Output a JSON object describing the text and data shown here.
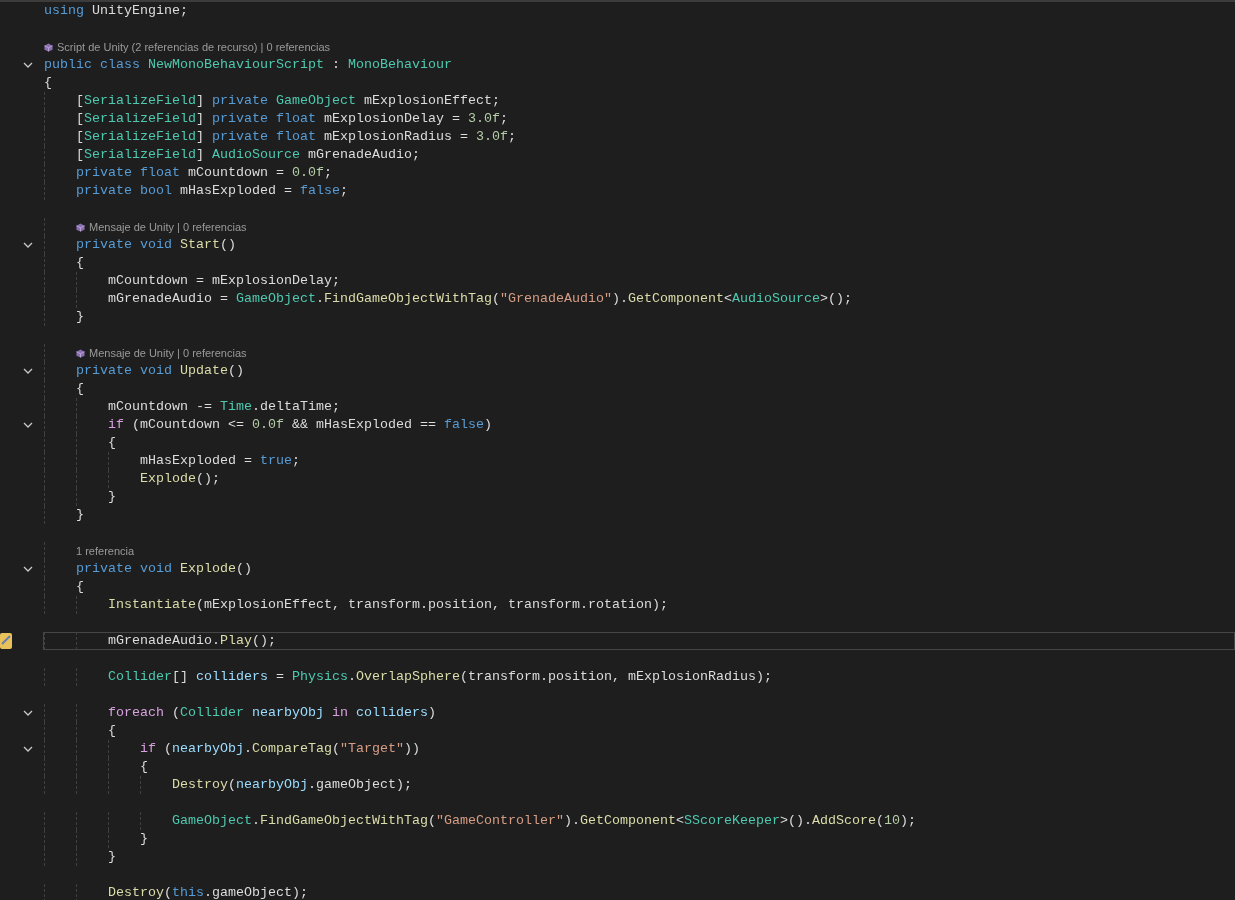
{
  "lines": [
    {
      "kind": "code",
      "current": false,
      "tokens": [
        {
          "kind": "keyword",
          "text": "using"
        },
        {
          "kind": "plain",
          "text": " UnityEngine;"
        }
      ]
    },
    {
      "kind": "blank",
      "current": false
    },
    {
      "kind": "lens",
      "current": false,
      "unity_icon": true,
      "text": "Script de Unity (2 referencias de recurso) | 0 referencias"
    },
    {
      "kind": "code",
      "current": false,
      "expanded": true,
      "tokens": [
        {
          "kind": "keyword",
          "text": "public class "
        },
        {
          "kind": "type",
          "text": "NewMonoBehaviourScript"
        },
        {
          "kind": "plain",
          "text": " : "
        },
        {
          "kind": "type",
          "text": "MonoBehaviour"
        }
      ]
    },
    {
      "kind": "code",
      "current": false,
      "tokens": [
        {
          "kind": "plain",
          "text": "{"
        }
      ]
    },
    {
      "kind": "code",
      "current": false,
      "tokens": [
        {
          "kind": "plain",
          "text": "    ["
        },
        {
          "kind": "type",
          "text": "SerializeField"
        },
        {
          "kind": "plain",
          "text": "] "
        },
        {
          "kind": "keyword",
          "text": "private "
        },
        {
          "kind": "type",
          "text": "GameObject"
        },
        {
          "kind": "plain",
          "text": " mExplosionEffect;"
        }
      ]
    },
    {
      "kind": "code",
      "current": false,
      "tokens": [
        {
          "kind": "plain",
          "text": "    ["
        },
        {
          "kind": "type",
          "text": "SerializeField"
        },
        {
          "kind": "plain",
          "text": "] "
        },
        {
          "kind": "keyword",
          "text": "private float"
        },
        {
          "kind": "plain",
          "text": " mExplosionDelay = "
        },
        {
          "kind": "number",
          "text": "3.0f"
        },
        {
          "kind": "plain",
          "text": ";"
        }
      ]
    },
    {
      "kind": "code",
      "current": false,
      "tokens": [
        {
          "kind": "plain",
          "text": "    ["
        },
        {
          "kind": "type",
          "text": "SerializeField"
        },
        {
          "kind": "plain",
          "text": "] "
        },
        {
          "kind": "keyword",
          "text": "private float"
        },
        {
          "kind": "plain",
          "text": " mExplosionRadius = "
        },
        {
          "kind": "number",
          "text": "3.0f"
        },
        {
          "kind": "plain",
          "text": ";"
        }
      ]
    },
    {
      "kind": "code",
      "current": false,
      "tokens": [
        {
          "kind": "plain",
          "text": "    ["
        },
        {
          "kind": "type",
          "text": "SerializeField"
        },
        {
          "kind": "plain",
          "text": "] "
        },
        {
          "kind": "type",
          "text": "AudioSource"
        },
        {
          "kind": "plain",
          "text": " mGrenadeAudio;"
        }
      ]
    },
    {
      "kind": "code",
      "current": false,
      "tokens": [
        {
          "kind": "keyword",
          "text": "    private float"
        },
        {
          "kind": "plain",
          "text": " mCountdown = "
        },
        {
          "kind": "number",
          "text": "0.0f"
        },
        {
          "kind": "plain",
          "text": ";"
        }
      ]
    },
    {
      "kind": "code",
      "current": false,
      "tokens": [
        {
          "kind": "keyword",
          "text": "    private bool"
        },
        {
          "kind": "plain",
          "text": " mHasExploded = "
        },
        {
          "kind": "keyword",
          "text": "false"
        },
        {
          "kind": "plain",
          "text": ";"
        }
      ]
    },
    {
      "kind": "blank",
      "current": false
    },
    {
      "kind": "lens",
      "current": false,
      "unity_icon": true,
      "text": "Mensaje de Unity | 0 referencias"
    },
    {
      "kind": "code",
      "current": false,
      "expanded": true,
      "tokens": [
        {
          "kind": "keyword",
          "text": "    private void "
        },
        {
          "kind": "method",
          "text": "Start"
        },
        {
          "kind": "plain",
          "text": "()"
        }
      ]
    },
    {
      "kind": "code",
      "current": false,
      "tokens": [
        {
          "kind": "plain",
          "text": "    {"
        }
      ]
    },
    {
      "kind": "code",
      "current": false,
      "tokens": [
        {
          "kind": "plain",
          "text": "        mCountdown = mExplosionDelay;"
        }
      ]
    },
    {
      "kind": "code",
      "current": false,
      "tokens": [
        {
          "kind": "plain",
          "text": "        mGrenadeAudio = "
        },
        {
          "kind": "type",
          "text": "GameObject"
        },
        {
          "kind": "plain",
          "text": "."
        },
        {
          "kind": "method",
          "text": "FindGameObjectWithTag"
        },
        {
          "kind": "plain",
          "text": "("
        },
        {
          "kind": "string",
          "text": "\"GrenadeAudio\""
        },
        {
          "kind": "plain",
          "text": ")."
        },
        {
          "kind": "method",
          "text": "GetComponent"
        },
        {
          "kind": "plain",
          "text": "<"
        },
        {
          "kind": "type",
          "text": "AudioSource"
        },
        {
          "kind": "plain",
          "text": ">();"
        }
      ]
    },
    {
      "kind": "code",
      "current": false,
      "tokens": [
        {
          "kind": "plain",
          "text": "    }"
        }
      ]
    },
    {
      "kind": "blank",
      "current": false
    },
    {
      "kind": "lens",
      "current": false,
      "unity_icon": true,
      "text": "Mensaje de Unity | 0 referencias"
    },
    {
      "kind": "code",
      "current": false,
      "expanded": true,
      "tokens": [
        {
          "kind": "keyword",
          "text": "    private void "
        },
        {
          "kind": "method",
          "text": "Update"
        },
        {
          "kind": "plain",
          "text": "()"
        }
      ]
    },
    {
      "kind": "code",
      "current": false,
      "tokens": [
        {
          "kind": "plain",
          "text": "    {"
        }
      ]
    },
    {
      "kind": "code",
      "current": false,
      "tokens": [
        {
          "kind": "plain",
          "text": "        mCountdown -= "
        },
        {
          "kind": "type",
          "text": "Time"
        },
        {
          "kind": "plain",
          "text": ".deltaTime;"
        }
      ]
    },
    {
      "kind": "code",
      "current": false,
      "expanded": true,
      "tokens": [
        {
          "kind": "control",
          "text": "        if"
        },
        {
          "kind": "plain",
          "text": " (mCountdown <= "
        },
        {
          "kind": "number",
          "text": "0.0f"
        },
        {
          "kind": "plain",
          "text": " && mHasExploded == "
        },
        {
          "kind": "keyword",
          "text": "false"
        },
        {
          "kind": "plain",
          "text": ")"
        }
      ]
    },
    {
      "kind": "code",
      "current": false,
      "tokens": [
        {
          "kind": "plain",
          "text": "        {"
        }
      ]
    },
    {
      "kind": "code",
      "current": false,
      "tokens": [
        {
          "kind": "plain",
          "text": "            mHasExploded = "
        },
        {
          "kind": "keyword",
          "text": "true"
        },
        {
          "kind": "plain",
          "text": ";"
        }
      ]
    },
    {
      "kind": "code",
      "current": false,
      "tokens": [
        {
          "kind": "method",
          "text": "            Explode"
        },
        {
          "kind": "plain",
          "text": "();"
        }
      ]
    },
    {
      "kind": "code",
      "current": false,
      "tokens": [
        {
          "kind": "plain",
          "text": "        }"
        }
      ]
    },
    {
      "kind": "code",
      "current": false,
      "tokens": [
        {
          "kind": "plain",
          "text": "    }"
        }
      ]
    },
    {
      "kind": "blank",
      "current": false
    },
    {
      "kind": "lens",
      "current": false,
      "unity_icon": false,
      "text": "1 referencia"
    },
    {
      "kind": "code",
      "current": false,
      "expanded": true,
      "tokens": [
        {
          "kind": "keyword",
          "text": "    private void "
        },
        {
          "kind": "method",
          "text": "Explode"
        },
        {
          "kind": "plain",
          "text": "()"
        }
      ]
    },
    {
      "kind": "code",
      "current": false,
      "tokens": [
        {
          "kind": "plain",
          "text": "    {"
        }
      ]
    },
    {
      "kind": "code",
      "current": false,
      "tokens": [
        {
          "kind": "method",
          "text": "        Instantiate"
        },
        {
          "kind": "plain",
          "text": "(mExplosionEffect, transform.position, transform.rotation);"
        }
      ]
    },
    {
      "kind": "blank",
      "current": false
    },
    {
      "kind": "code",
      "current": true,
      "tokens": [
        {
          "kind": "plain",
          "text": "        mGrenadeAudio."
        },
        {
          "kind": "method",
          "text": "Play"
        },
        {
          "kind": "plain",
          "text": "();"
        }
      ]
    },
    {
      "kind": "blank",
      "current": false
    },
    {
      "kind": "code",
      "current": false,
      "tokens": [
        {
          "kind": "type",
          "text": "        Collider"
        },
        {
          "kind": "plain",
          "text": "[] "
        },
        {
          "kind": "local",
          "text": "colliders"
        },
        {
          "kind": "plain",
          "text": " = "
        },
        {
          "kind": "type",
          "text": "Physics"
        },
        {
          "kind": "plain",
          "text": "."
        },
        {
          "kind": "method",
          "text": "OverlapSphere"
        },
        {
          "kind": "plain",
          "text": "(transform.position, mExplosionRadius);"
        }
      ]
    },
    {
      "kind": "blank",
      "current": false
    },
    {
      "kind": "code",
      "current": false,
      "expanded": true,
      "tokens": [
        {
          "kind": "control",
          "text": "        foreach"
        },
        {
          "kind": "plain",
          "text": " ("
        },
        {
          "kind": "type",
          "text": "Collider "
        },
        {
          "kind": "local",
          "text": "nearbyObj "
        },
        {
          "kind": "control",
          "text": "in "
        },
        {
          "kind": "local",
          "text": "colliders"
        },
        {
          "kind": "plain",
          "text": ")"
        }
      ]
    },
    {
      "kind": "code",
      "current": false,
      "tokens": [
        {
          "kind": "plain",
          "text": "        {"
        }
      ]
    },
    {
      "kind": "code",
      "current": false,
      "expanded": true,
      "tokens": [
        {
          "kind": "control",
          "text": "            if"
        },
        {
          "kind": "plain",
          "text": " ("
        },
        {
          "kind": "local",
          "text": "nearbyObj"
        },
        {
          "kind": "plain",
          "text": "."
        },
        {
          "kind": "method",
          "text": "CompareTag"
        },
        {
          "kind": "plain",
          "text": "("
        },
        {
          "kind": "string",
          "text": "\"Target\""
        },
        {
          "kind": "plain",
          "text": "))"
        }
      ]
    },
    {
      "kind": "code",
      "current": false,
      "tokens": [
        {
          "kind": "plain",
          "text": "            {"
        }
      ]
    },
    {
      "kind": "code",
      "current": false,
      "tokens": [
        {
          "kind": "method",
          "text": "                Destroy"
        },
        {
          "kind": "plain",
          "text": "("
        },
        {
          "kind": "local",
          "text": "nearbyObj"
        },
        {
          "kind": "plain",
          "text": ".gameObject);"
        }
      ]
    },
    {
      "kind": "blank",
      "current": false
    },
    {
      "kind": "code",
      "current": false,
      "tokens": [
        {
          "kind": "type",
          "text": "                GameObject"
        },
        {
          "kind": "plain",
          "text": "."
        },
        {
          "kind": "method",
          "text": "FindGameObjectWithTag"
        },
        {
          "kind": "plain",
          "text": "("
        },
        {
          "kind": "string",
          "text": "\"GameController\""
        },
        {
          "kind": "plain",
          "text": ")."
        },
        {
          "kind": "method",
          "text": "GetComponent"
        },
        {
          "kind": "plain",
          "text": "<"
        },
        {
          "kind": "type",
          "text": "SScoreKeeper"
        },
        {
          "kind": "plain",
          "text": ">()."
        },
        {
          "kind": "method",
          "text": "AddScore"
        },
        {
          "kind": "plain",
          "text": "("
        },
        {
          "kind": "number",
          "text": "10"
        },
        {
          "kind": "plain",
          "text": ");"
        }
      ]
    },
    {
      "kind": "code",
      "current": false,
      "tokens": [
        {
          "kind": "plain",
          "text": "            }"
        }
      ]
    },
    {
      "kind": "code",
      "current": false,
      "tokens": [
        {
          "kind": "plain",
          "text": "        }"
        }
      ]
    },
    {
      "kind": "blank",
      "current": false
    },
    {
      "kind": "code",
      "current": false,
      "tokens": [
        {
          "kind": "method",
          "text": "        Destroy"
        },
        {
          "kind": "plain",
          "text": "("
        },
        {
          "kind": "keyword",
          "text": "this"
        },
        {
          "kind": "plain",
          "text": ".gameObject);"
        }
      ]
    }
  ]
}
